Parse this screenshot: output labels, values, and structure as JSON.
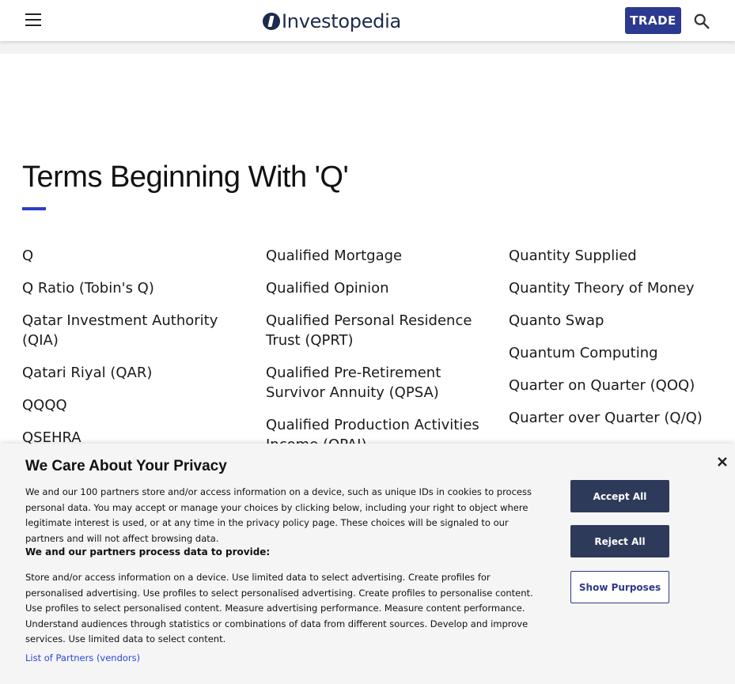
{
  "header": {
    "logo_text": "Investopedia",
    "trade_label": "TRADE"
  },
  "section": {
    "title": "Terms Beginning With 'Q'"
  },
  "terms": {
    "col1": [
      "Q",
      "Q Ratio (Tobin's Q)",
      "Qatar Investment Authority (QIA)",
      "Qatari Riyal (QAR)",
      "QQQQ",
      "QSEHRA"
    ],
    "col2": [
      "Qualified Mortgage",
      "Qualified Opinion",
      "Qualified Personal Residence Trust (QPRT)",
      "Qualified Pre-Retirement Survivor Annuity (QPSA)",
      "Qualified Production Activities Income (QPAI)"
    ],
    "col3": [
      "Quantity Supplied",
      "Quantity Theory of Money",
      "Quanto Swap",
      "Quantum Computing",
      "Quarter on Quarter (QOQ)",
      "Quarter over Quarter (Q/Q)"
    ]
  },
  "privacy": {
    "title": "We Care About Your Privacy",
    "body": "We and our 100 partners store and/or access information on a device, such as unique IDs in cookies to process personal data. You may accept or manage your choices by clicking below, including your right to object where legitimate interest is used, or at any time in the privacy policy page. These choices will be signaled to our partners and will not affect browsing data.",
    "subhead": "We and our partners process data to provide:",
    "purposes": "Store and/or access information on a device. Use limited data to select advertising. Create profiles for personalised advertising. Use profiles to select personalised advertising. Create profiles to personalise content. Use profiles to select personalised content. Measure advertising performance. Measure content performance. Understand audiences through statistics or combinations of data from different sources. Develop and improve services. Use limited data to select content.",
    "partners_link": "List of Partners (vendors)",
    "accept_label": "Accept All",
    "reject_label": "Reject All",
    "purposes_label": "Show Purposes"
  }
}
